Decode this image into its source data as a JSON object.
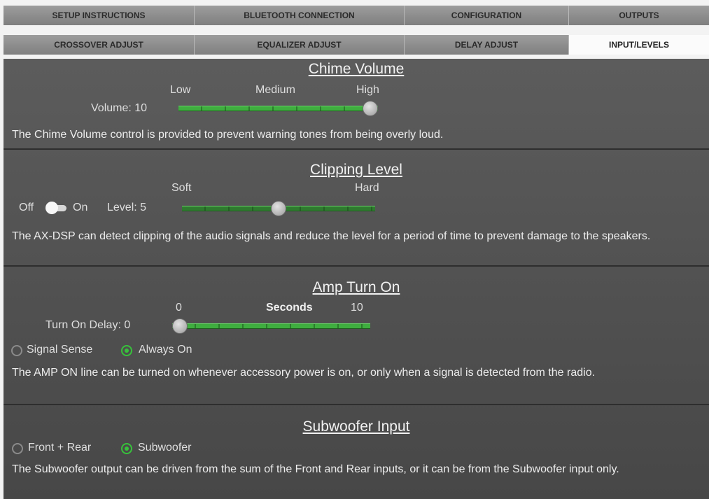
{
  "tabs": {
    "row1": [
      "SETUP INSTRUCTIONS",
      "BLUETOOTH CONNECTION",
      "CONFIGURATION",
      "OUTPUTS"
    ],
    "row2": [
      "CROSSOVER ADJUST",
      "EQUALIZER ADJUST",
      "DELAY ADJUST",
      "INPUT/LEVELS"
    ],
    "active": "INPUT/LEVELS"
  },
  "chime": {
    "title": "Chime Volume",
    "scale_low": "Low",
    "scale_medium": "Medium",
    "scale_high": "High",
    "volume_label": "Volume: 10",
    "volume_value": 10,
    "volume_max": 10,
    "description": "The Chime Volume control is provided to prevent warning tones from being overly loud."
  },
  "clipping": {
    "title": "Clipping Level",
    "scale_soft": "Soft",
    "scale_hard": "Hard",
    "off_label": "Off",
    "on_label": "On",
    "toggle_state": "off",
    "level_label": "Level: 5",
    "level_value": 5,
    "level_max": 10,
    "description": "The AX-DSP can detect clipping of the audio signals and reduce the level for a period of time to prevent damage to the speakers."
  },
  "amp": {
    "title": "Amp Turn On",
    "scale_min": "0",
    "scale_unit": "Seconds",
    "scale_max": "10",
    "delay_label": "Turn On Delay: 0",
    "delay_value": 0,
    "delay_max": 10,
    "option_signal_sense": "Signal Sense",
    "option_always_on": "Always On",
    "selected": "Always On",
    "description": "The AMP ON line can be turned on whenever accessory power is on, or only when a signal is detected from the radio."
  },
  "subwoofer": {
    "title": "Subwoofer Input",
    "option_front_rear": "Front + Rear",
    "option_subwoofer": "Subwoofer",
    "selected": "Subwoofer",
    "description": "The Subwoofer output can be driven from the sum of the Front and Rear inputs, or it can be from the Subwoofer input only."
  },
  "colors": {
    "accent_green": "#37c23b",
    "panel_bg": "#555555",
    "tab_bg": "#8f8f8f",
    "active_tab_bg": "#fbfbfb"
  }
}
